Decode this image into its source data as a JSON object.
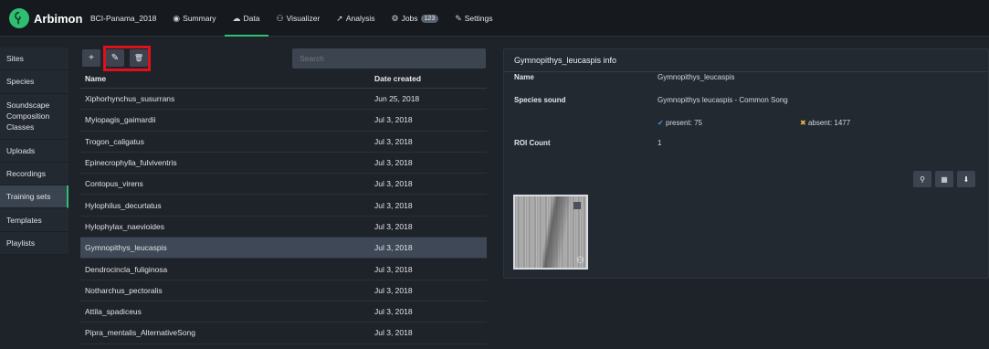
{
  "app": {
    "brand": "Arbimon"
  },
  "nav": {
    "project": "BCI-Panama_2018",
    "items": [
      {
        "label": "Summary",
        "icon": "dashboard-icon",
        "glyph": "◉"
      },
      {
        "label": "Data",
        "icon": "cloud-icon",
        "glyph": "☁"
      },
      {
        "label": "Visualizer",
        "icon": "binoculars-icon",
        "glyph": "⚇"
      },
      {
        "label": "Analysis",
        "icon": "send-icon",
        "glyph": "➚"
      },
      {
        "label": "Jobs",
        "icon": "gears-icon",
        "glyph": "⚙",
        "badge": "123"
      },
      {
        "label": "Settings",
        "icon": "wrench-icon",
        "glyph": "✎"
      }
    ]
  },
  "sidebar": {
    "items": [
      {
        "label": "Sites"
      },
      {
        "label": "Species"
      },
      {
        "label": "Soundscape Composition Classes"
      },
      {
        "label": "Uploads"
      },
      {
        "label": "Recordings"
      },
      {
        "label": "Training sets"
      },
      {
        "label": "Templates"
      },
      {
        "label": "Playlists"
      }
    ]
  },
  "toolbar": {
    "add": "+",
    "edit": "✎",
    "delete": "🗑"
  },
  "search": {
    "placeholder": "Search"
  },
  "table": {
    "headers": {
      "name": "Name",
      "date": "Date created"
    },
    "rows": [
      {
        "name": "Xiphorhynchus_susurrans",
        "date": "Jun 25, 2018"
      },
      {
        "name": "Myiopagis_gaimardii",
        "date": "Jul 3, 2018"
      },
      {
        "name": "Trogon_caligatus",
        "date": "Jul 3, 2018"
      },
      {
        "name": "Epinecrophylla_fulviventris",
        "date": "Jul 3, 2018"
      },
      {
        "name": "Contopus_virens",
        "date": "Jul 3, 2018"
      },
      {
        "name": "Hylophilus_decurtatus",
        "date": "Jul 3, 2018"
      },
      {
        "name": "Hylophylax_naevioides",
        "date": "Jul 3, 2018"
      },
      {
        "name": "Gymnopithys_leucaspis",
        "date": "Jul 3, 2018"
      },
      {
        "name": "Dendrocincla_fuliginosa",
        "date": "Jul 3, 2018"
      },
      {
        "name": "Notharchus_pectoralis",
        "date": "Jul 3, 2018"
      },
      {
        "name": "Attila_spadiceus",
        "date": "Jul 3, 2018"
      },
      {
        "name": "Pipra_mentalis_AlternativeSong",
        "date": "Jul 3, 2018"
      }
    ],
    "selected_index": 7
  },
  "info": {
    "title": "Gymnopithys_leucaspis info",
    "name_label": "Name",
    "name_value": "Gymnopithys_leucaspis",
    "sound_label": "Species sound",
    "sound_value": "Gymnopithys leucaspis - Common Song",
    "present": "present: 75",
    "absent": "absent: 1477",
    "roi_label": "ROI Count",
    "roi_value": "1"
  },
  "colors": {
    "accent": "#2fbf71",
    "highlight": "#e0101a"
  }
}
